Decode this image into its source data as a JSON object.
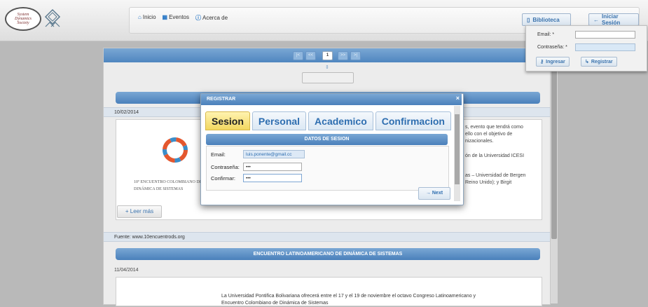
{
  "header": {
    "logo_text": "System\nDynamics\nSociety",
    "nav": [
      {
        "label": "Inicio",
        "icon": "home-icon"
      },
      {
        "label": "Eventos",
        "icon": "calendar-icon"
      },
      {
        "label": "Acerca de",
        "icon": "info-icon"
      }
    ],
    "biblioteca_label": "Biblioteca",
    "login_label": "Iniciar Sesión"
  },
  "login_popup": {
    "email_label": "Email: *",
    "password_label": "Contraseña: *",
    "ingresar_label": "Ingresar",
    "registrar_label": "Registrar"
  },
  "pager": {
    "current": "1",
    "buttons": [
      "|<",
      "<<",
      "1",
      ">>",
      ">|"
    ]
  },
  "news": [
    {
      "title": "",
      "date": "10/02/2014",
      "text_fragments": [
        "s, evento que tendrá como",
        "ello con el objetivo de",
        "nizacionales.",
        "ón de la Universidad ICESI",
        "as – Universidad de Bergen",
        "Reino Unido); y Birgit"
      ],
      "image_caption": "10º ENCUENTRO COLOMBIANO DE DINÁMICA DE SISTEMAS",
      "more_label": "Leer más",
      "source": "Fuente: www.10encuentrods.org"
    },
    {
      "title": "ENCUENTRO LATINOAMERICANO DE DINÁMICA DE SISTEMAS",
      "date": "11/04/2014",
      "text_lines": [
        "La Universidad Pontifica Bolivariana ofrecerá entre el 17 y el 19 de noviembre el octavo Congreso Latinoamericano y",
        "Encuentro Colombiano de Dinámica de Sistemas"
      ]
    }
  ],
  "dialog": {
    "title": "REGISTRAR",
    "tabs": [
      "Sesion",
      "Personal",
      "Academico",
      "Confirmacion"
    ],
    "active_tab": "Sesion",
    "section_title": "DATOS DE SESION",
    "fields": {
      "email_label": "Email:",
      "email_value": "luis.ponente@gmail.cc",
      "password_label": "Contraseña:",
      "password_value": "•••",
      "confirm_label": "Confirmar:",
      "confirm_value": "•••"
    },
    "next_label": "Next"
  },
  "colors": {
    "accent": "#4a80bb",
    "active_tab": "#f2d760"
  }
}
